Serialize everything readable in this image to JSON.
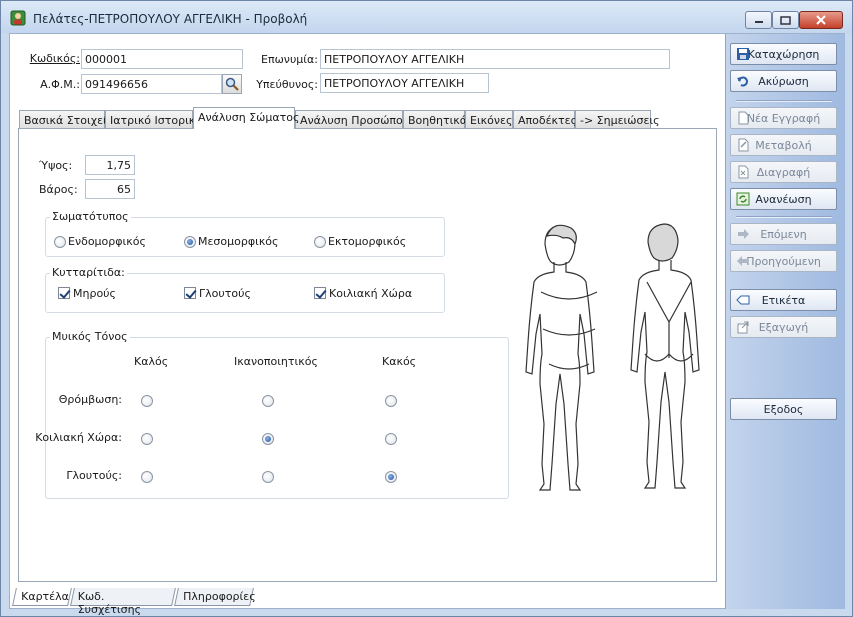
{
  "window": {
    "title": "Πελάτες-ΠΕΤΡΟΠΟΥΛΟΥ ΑΓΓΕΛΙΚΗ -  Προβολή"
  },
  "header": {
    "code_label": "Κωδικός:",
    "code_value": "000001",
    "afm_label": "Α.Φ.Μ.:",
    "afm_value": "091496656",
    "name_label": "Επωνυμία:",
    "name_value": "ΠΕΤΡΟΠΟΥΛΟΥ ΑΓΓΕΛΙΚΗ",
    "responsible_label": "Υπεύθυνος:",
    "responsible_value": "ΠΕΤΡΟΠΟΥΛΟΥ ΑΓΓΕΛΙΚΗ"
  },
  "tabs": [
    {
      "label": "Βασικά Στοιχεία"
    },
    {
      "label": "Ιατρικό Ιστορικό"
    },
    {
      "label": "Ανάλυση Σώματος"
    },
    {
      "label": "Ανάλυση Προσώπου"
    },
    {
      "label": "Βοηθητικά"
    },
    {
      "label": "Εικόνες"
    },
    {
      "label": "Αποδέκτες"
    },
    {
      "label": "-> Σημειώσεις"
    }
  ],
  "body": {
    "height_label": "Ύψος:",
    "height_value": "1,75",
    "weight_label": "Βάρος:",
    "weight_value": "65",
    "somatotype": {
      "title": "Σωματότυπος",
      "options": [
        "Ενδομορφικός",
        "Μεσομορφικός",
        "Εκτομορφικός"
      ],
      "selected": "Μεσομορφικός"
    },
    "cellulite": {
      "title": "Κυτταρίτιδα:",
      "items": [
        {
          "label": "Μηρούς",
          "checked": true
        },
        {
          "label": "Γλουτούς",
          "checked": true
        },
        {
          "label": "Κοιλιακή Χώρα",
          "checked": true
        }
      ]
    },
    "muscle_tone": {
      "title": "Μυικός Τόνος",
      "columns": [
        "Καλός",
        "Ικανοποιητικός",
        "Κακός"
      ],
      "rows": [
        {
          "label": "Θρόμβωση:",
          "selected": null
        },
        {
          "label": "Κοιλιακή Χώρα:",
          "selected": "Ικανοποιητικός"
        },
        {
          "label": "Γλουτούς:",
          "selected": "Κακός"
        }
      ]
    }
  },
  "side_buttons": {
    "save": "Καταχώρηση",
    "cancel": "Ακύρωση",
    "new": "Νέα Εγγραφή",
    "edit": "Μεταβολή",
    "delete": "Διαγραφή",
    "refresh": "Ανανέωση",
    "next": "Επόμενη",
    "previous": "Προηγούμενη",
    "label": "Ετικέτα",
    "export": "Εξαγωγή",
    "exit": "Εξοδος"
  },
  "bottom_tabs": [
    "Καρτέλα",
    "Κωδ. Συσχέτισης",
    "Πληροφορίες"
  ],
  "colors": {
    "window_frame": "#c9d9ee",
    "side_panel": "#9fb9e0",
    "close_button": "#c4402b"
  }
}
